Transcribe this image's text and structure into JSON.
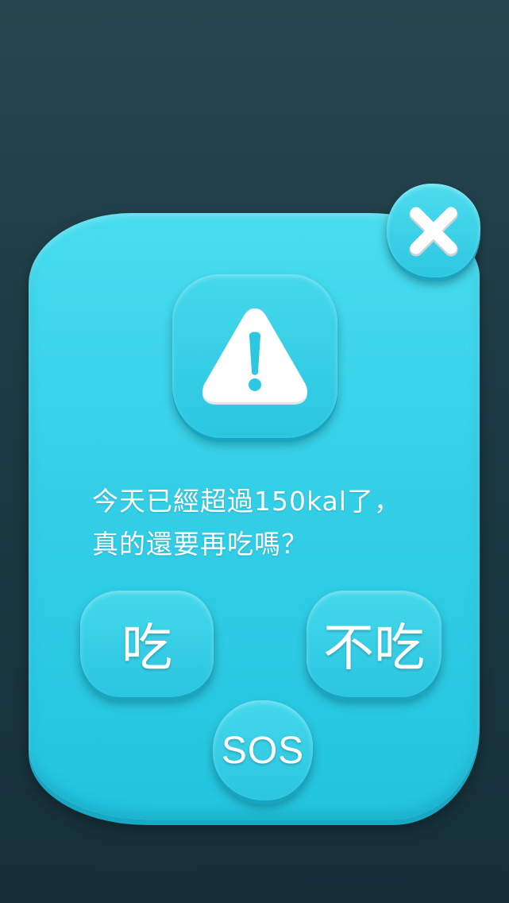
{
  "dialog": {
    "close_icon": "close-x-icon",
    "warning_icon": "warning-triangle-icon",
    "message_line1": "今天已經超過150kal了，",
    "message_line2": "真的還要再吃嗎？",
    "eat_label": "吃",
    "no_eat_label": "不吃",
    "sos_label": "SOS"
  },
  "colors": {
    "background": "#1d3a44",
    "panel": "#36d0e8",
    "text": "#ffffff"
  }
}
